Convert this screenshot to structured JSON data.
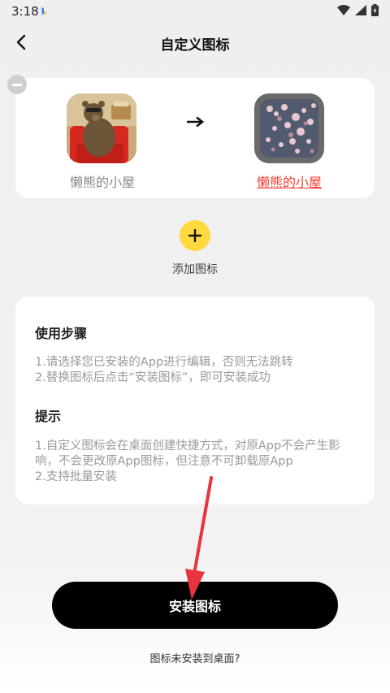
{
  "status": {
    "time": "3:18"
  },
  "header": {
    "title": "自定义图标"
  },
  "icons": {
    "original_name": "懒熊的小屋",
    "custom_name": "懒熊的小屋"
  },
  "add": {
    "label": "添加图标"
  },
  "usage": {
    "title": "使用步骤",
    "lines": [
      "1.请选择您已安装的App进行编辑，否则无法跳转",
      "2.替换图标后点击“安装图标”，即可安装成功"
    ]
  },
  "tips": {
    "title": "提示",
    "lines": [
      "1.自定义图标会在桌面创建快捷方式，对原App不会产生影",
      "响，不会更改原App图标，但注意不可卸载原App",
      "2.支持批量安装"
    ]
  },
  "footer": {
    "install_label": "安装图标",
    "help_text": "图标未安装到桌面?"
  },
  "colors": {
    "accent_yellow": "#ffd93d",
    "link_red": "#ff3b30",
    "button_black": "#000000"
  }
}
